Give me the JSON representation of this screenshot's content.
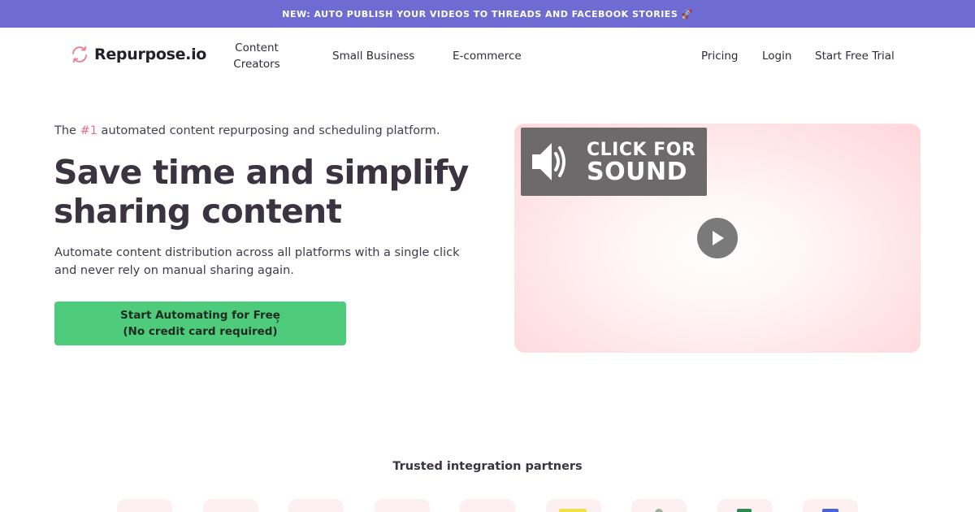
{
  "announcement": {
    "text": "NEW: AUTO PUBLISH YOUR VIDEOS TO THREADS AND FACEBOOK STORIES 🚀"
  },
  "nav": {
    "logo_text": "Repurpose.io",
    "links": {
      "content_creators_line1": "Content",
      "content_creators_line2": "Creators",
      "small_business": "Small Business",
      "ecommerce": "E-commerce",
      "pricing": "Pricing",
      "login": "Login",
      "free_trial": "Start Free Trial"
    }
  },
  "hero": {
    "tagline_prefix": "The ",
    "tagline_highlight": "#1",
    "tagline_suffix": " automated content repurposing and scheduling platform.",
    "headline_line1": "Save time and simplify",
    "headline_line2": "sharing content",
    "description": "Automate content distribution across all platforms with a single click and never rely on manual sharing again.",
    "cta_line1": "Start Automating for Free",
    "cta_line2": "(No credit card required)",
    "cta_arrow": "›"
  },
  "video": {
    "sound_line1": "CLICK FOR",
    "sound_line2": "SOUND"
  },
  "partners": {
    "title": "Trusted integration partners"
  },
  "colors": {
    "announcement_bg": "#6e6bd3",
    "cta_bg": "#4ecc7c",
    "accent_pink": "#ee6d86",
    "heading": "#3a3440"
  },
  "icons": [
    "repurpose-logo-icon",
    "speaker-icon",
    "play-icon",
    "chevron-right-icon"
  ]
}
